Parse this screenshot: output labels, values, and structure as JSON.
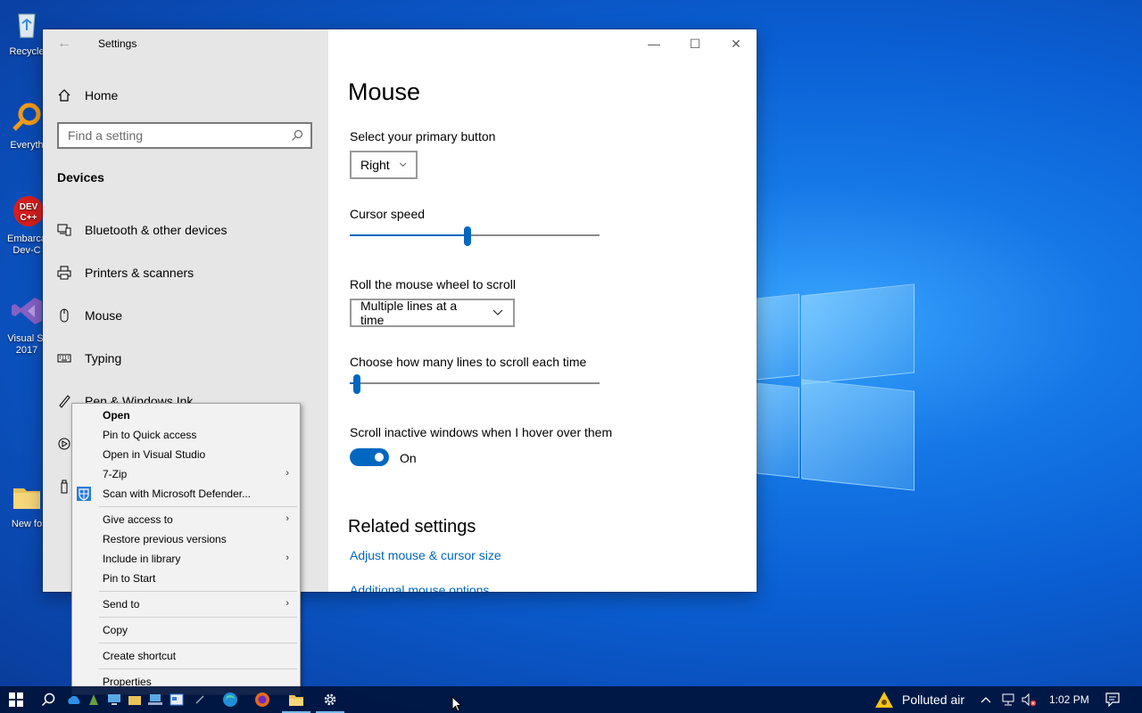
{
  "desktop": {
    "icons": [
      {
        "label": "Recycle",
        "icon": "recycle-bin-icon"
      },
      {
        "label": "Everyth",
        "icon": "everything-search-icon"
      },
      {
        "label": "Embarca Dev-C",
        "icon": "devcpp-icon"
      },
      {
        "label": "Visual St 2017",
        "icon": "visual-studio-icon"
      },
      {
        "label": "New fo",
        "icon": "folder-icon"
      }
    ]
  },
  "window": {
    "title": "Settings",
    "controls": {
      "minimize": "—",
      "maximize": "☐",
      "close": "✕"
    }
  },
  "sidebar": {
    "home_label": "Home",
    "search_placeholder": "Find a setting",
    "section_title": "Devices",
    "items": [
      {
        "label": "Bluetooth & other devices",
        "icon": "bluetooth-devices-icon"
      },
      {
        "label": "Printers & scanners",
        "icon": "printer-icon"
      },
      {
        "label": "Mouse",
        "icon": "mouse-icon"
      },
      {
        "label": "Typing",
        "icon": "keyboard-icon"
      },
      {
        "label": "Pen & Windows Ink",
        "icon": "pen-icon"
      }
    ]
  },
  "main": {
    "title": "Mouse",
    "primary_button": {
      "label": "Select your primary button",
      "value": "Right"
    },
    "cursor_speed": {
      "label": "Cursor speed",
      "value_fraction": 0.47
    },
    "wheel_scroll": {
      "label": "Roll the mouse wheel to scroll",
      "value": "Multiple lines at a time"
    },
    "lines_scroll": {
      "label": "Choose how many lines to scroll each time",
      "value_fraction": 0.03
    },
    "inactive_scroll": {
      "label": "Scroll inactive windows when I hover over them",
      "state": "On"
    },
    "related_title": "Related settings",
    "links": [
      "Adjust mouse & cursor size",
      "Additional mouse options"
    ]
  },
  "context_menu": {
    "items": [
      {
        "label": "Open",
        "bold": true
      },
      {
        "label": "Pin to Quick access"
      },
      {
        "label": "Open in Visual Studio"
      },
      {
        "label": "7-Zip",
        "submenu": true
      },
      {
        "label": "Scan with Microsoft Defender...",
        "icon": "defender-icon"
      },
      {
        "label": "Give access to",
        "submenu": true
      },
      {
        "label": "Restore previous versions"
      },
      {
        "label": "Include in library",
        "submenu": true
      },
      {
        "label": "Pin to Start"
      },
      {
        "label": "Send to",
        "submenu": true
      },
      {
        "label": "Copy"
      },
      {
        "label": "Create shortcut"
      },
      {
        "label": "Properties"
      }
    ],
    "submenu_arrow": "›"
  },
  "taskbar": {
    "weather": "Polluted air",
    "clock": "1:02 PM",
    "colors": {
      "accent": "#0067c0",
      "taskbar": "#001a3d"
    }
  }
}
